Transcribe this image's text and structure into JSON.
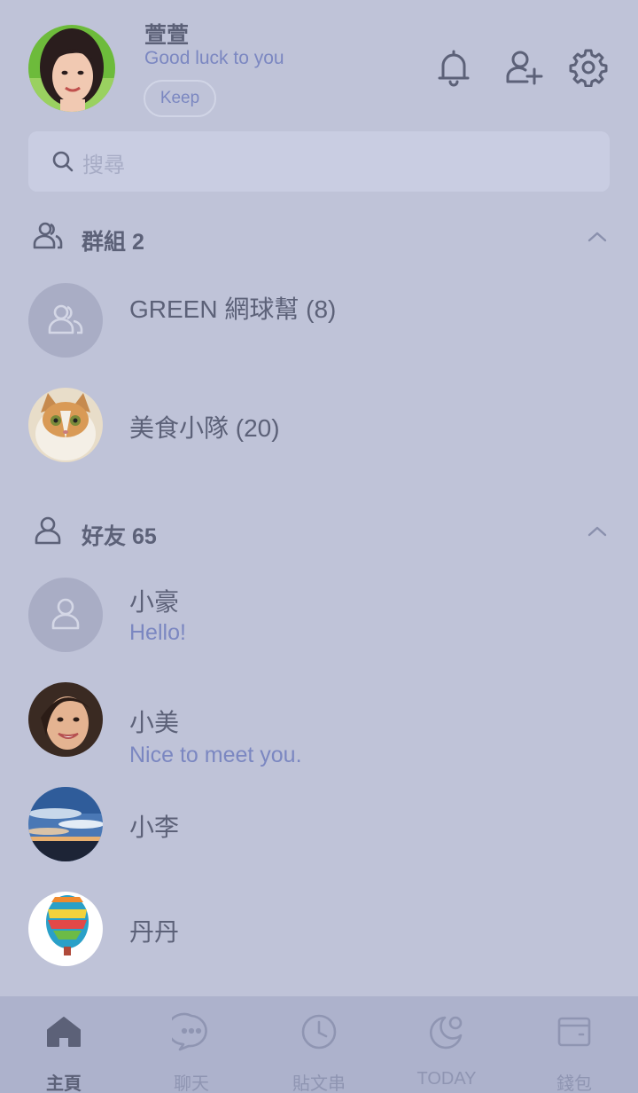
{
  "profile": {
    "name": "萱萱",
    "status": "Good luck to you",
    "keep_label": "Keep"
  },
  "header_icons": [
    "bell-icon",
    "add-friend-icon",
    "gear-icon"
  ],
  "search": {
    "placeholder": "搜尋"
  },
  "groups_section": {
    "title": "群組 2",
    "items": [
      {
        "name": "GREEN 網球幫 (8)",
        "avatar": "group-placeholder"
      },
      {
        "name": "美食小隊 (20)",
        "avatar": "cat-photo"
      }
    ]
  },
  "friends_section": {
    "title": "好友 65",
    "items": [
      {
        "name": "小豪",
        "message": "Hello!",
        "avatar": "user-placeholder"
      },
      {
        "name": "小美",
        "message": "Nice to meet you.",
        "avatar": "woman-photo"
      },
      {
        "name": "小李",
        "message": "",
        "avatar": "sky-photo"
      },
      {
        "name": "丹丹",
        "message": "",
        "avatar": "balloon-photo"
      }
    ]
  },
  "nav": [
    {
      "label": "主頁",
      "icon": "home-icon",
      "active": true
    },
    {
      "label": "聊天",
      "icon": "chat-icon",
      "active": false
    },
    {
      "label": "貼文串",
      "icon": "clock-icon",
      "active": false
    },
    {
      "label": "TODAY",
      "icon": "today-icon",
      "active": false
    },
    {
      "label": "錢包",
      "icon": "wallet-icon",
      "active": false
    }
  ],
  "colors": {
    "background": "#bfc3d8",
    "accent_text": "#7b87c1",
    "primary_text": "#5c6178",
    "nav_background": "#adb2cc"
  }
}
